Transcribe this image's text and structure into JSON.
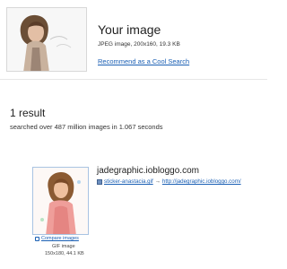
{
  "query": {
    "title": "Your image",
    "meta": "JPEG image, 200x160, 19.3 KB",
    "recommend_link": "Recommend as a Cool Search"
  },
  "results": {
    "count_label": "1 result",
    "stats": "searched over 487 million images in 1.067 seconds"
  },
  "match": {
    "domain": "jadegraphic.iobloggo.com",
    "file_link": "sticker-anastacia.gif",
    "arrow": "→",
    "page_link": "http://jadegraphic.iobloggo.com/",
    "compare_label": "Compare images",
    "type": "GIF image",
    "dims": "150x180, 44.1 KB"
  },
  "icons": {
    "file": "gif-file-icon",
    "compare": "compare-icon"
  }
}
